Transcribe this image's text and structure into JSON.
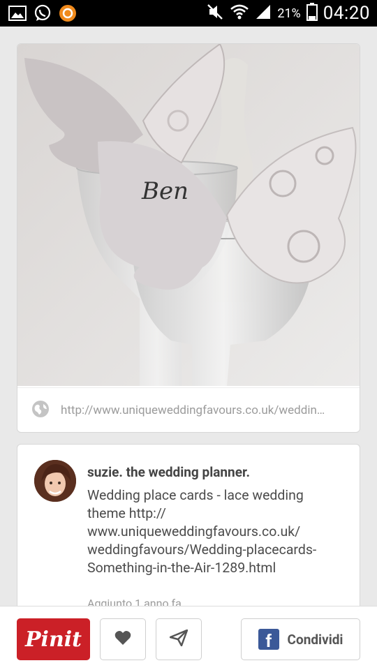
{
  "status_bar": {
    "battery_percent": "21%",
    "time": "04:20",
    "icons": [
      "image-icon",
      "whatsapp-icon",
      "app-icon",
      "mute-icon",
      "wifi-icon",
      "signal-icon",
      "battery-icon"
    ]
  },
  "pin": {
    "image_text": "Ben",
    "source_url": "http://www.uniqueweddingfavours.co.uk/weddin…"
  },
  "description": {
    "user_name": "suzie. the wedding planner.",
    "text": "Wedding place cards - lace wedding theme http:// www.uniqueweddingfavours.co.uk/ weddingfavours/Wedding-placecards-Something-in-the-Air-1289.html",
    "added": "Aggiunto 1 anno fa"
  },
  "actions": {
    "pin_it": "Pinit",
    "share": "Condividi"
  },
  "colors": {
    "pin_red": "#cb2027",
    "facebook_blue": "#3b5998"
  }
}
